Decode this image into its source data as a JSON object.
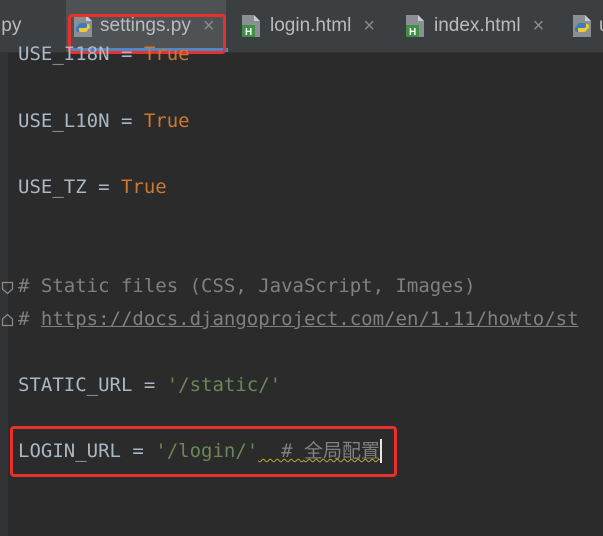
{
  "tabs": [
    {
      "label": ".py",
      "icon": "python-file-icon"
    },
    {
      "label": "settings.py",
      "icon": "python-file-icon",
      "active": true,
      "close": "×"
    },
    {
      "label": "login.html",
      "icon": "html-file-icon",
      "close": "×"
    },
    {
      "label": "index.html",
      "icon": "html-file-icon",
      "close": "×"
    },
    {
      "label": "u",
      "icon": "python-file-icon"
    }
  ],
  "code": {
    "line_i18n": {
      "name": "USE_I18N",
      "op": " = ",
      "value": "True"
    },
    "line_l10n": {
      "name": "USE_L10N",
      "op": " = ",
      "value": "True"
    },
    "line_tz": {
      "name": "USE_TZ",
      "op": " = ",
      "value": "True"
    },
    "line_static_comment": "# Static files (CSS, JavaScript, Images)",
    "line_docs_hash": "# ",
    "line_docs_link": "https://docs.djangoproject.com/en/1.11/howto/st",
    "line_static_url": {
      "name": "STATIC_URL",
      "op": " = ",
      "value": "'/static/'"
    },
    "line_login_url": {
      "name": "LOGIN_URL",
      "op": " = ",
      "value": "'/login/'",
      "comment_hash": "  # ",
      "comment_text": "全局配置"
    }
  },
  "colors": {
    "keyword": "#cc7832",
    "string": "#6a8759",
    "comment": "#808080",
    "highlight": "#e8302c",
    "background": "#2b2b2b"
  }
}
